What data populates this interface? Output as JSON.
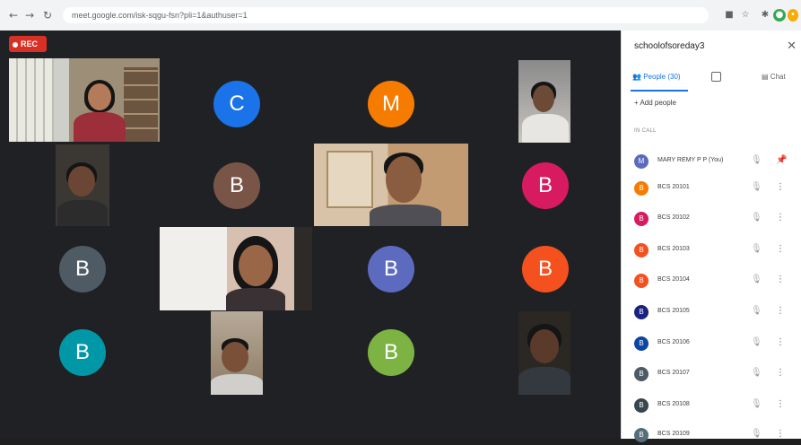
{
  "browser": {
    "url": "meet.google.com/isk-sqgu-fsn?pli=1&authuser=1"
  },
  "meeting": {
    "rec_label": "REC",
    "tiles": [
      {
        "kind": "video",
        "id": "v1"
      },
      {
        "kind": "avatar",
        "letter": "C",
        "color": "#1a73e8"
      },
      {
        "kind": "avatar",
        "letter": "M",
        "color": "#f57c00"
      },
      {
        "kind": "video",
        "id": "v2"
      },
      {
        "kind": "video",
        "id": "v3"
      },
      {
        "kind": "avatar",
        "letter": "B",
        "color": "#795548"
      },
      {
        "kind": "video",
        "id": "v4"
      },
      {
        "kind": "avatar",
        "letter": "B",
        "color": "#d81b60"
      },
      {
        "kind": "avatar",
        "letter": "B",
        "color": "#4e5b65"
      },
      {
        "kind": "video",
        "id": "v5"
      },
      {
        "kind": "avatar",
        "letter": "B",
        "color": "#5c6bc0"
      },
      {
        "kind": "avatar",
        "letter": "B",
        "color": "#f4511e"
      },
      {
        "kind": "avatar",
        "letter": "B",
        "color": "#0097a7"
      },
      {
        "kind": "video",
        "id": "v6"
      },
      {
        "kind": "avatar",
        "letter": "B",
        "color": "#7cb342"
      },
      {
        "kind": "video",
        "id": "v7"
      }
    ]
  },
  "panel": {
    "title": "schoolofsoreday3",
    "tabs": {
      "people": "People (30)",
      "chat": "Chat"
    },
    "add_people": "Add people",
    "section_label": "IN CALL",
    "people": [
      {
        "initial": "M",
        "name": "MARY REMY P P (You)",
        "color": "#5c6bc0"
      },
      {
        "initial": "B",
        "name": "BCS 20101",
        "color": "#f57c00"
      },
      {
        "initial": "B",
        "name": "BCS 20102",
        "color": "#d81b60"
      },
      {
        "initial": "B",
        "name": "BCS 20103",
        "color": "#f4511e"
      },
      {
        "initial": "B",
        "name": "BCS 20104",
        "color": "#f4511e"
      },
      {
        "initial": "B",
        "name": "BCS 20105",
        "color": "#1a237e"
      },
      {
        "initial": "B",
        "name": "BCS 20106",
        "color": "#0d47a1"
      },
      {
        "initial": "B",
        "name": "BCS 20107",
        "color": "#4e5b65"
      },
      {
        "initial": "B",
        "name": "BCS 20108",
        "color": "#37474f"
      },
      {
        "initial": "B",
        "name": "BCS 20109",
        "color": "#546e7a"
      }
    ]
  }
}
